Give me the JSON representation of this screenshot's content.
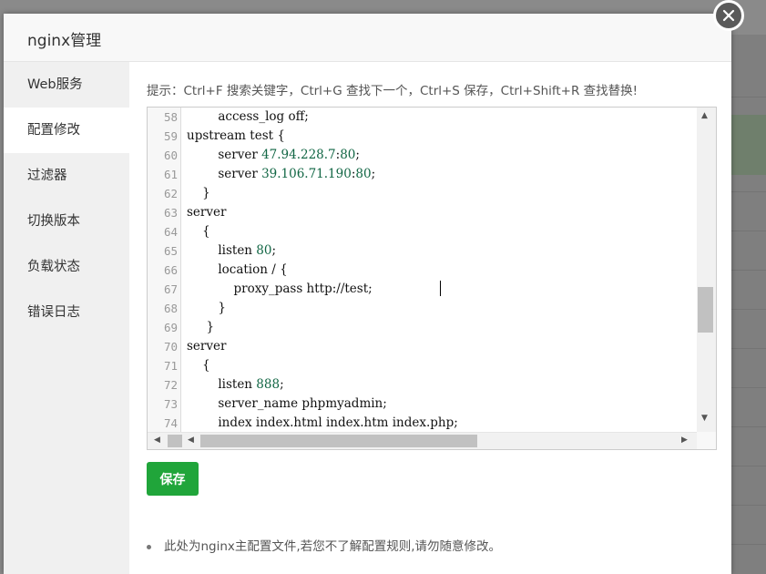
{
  "dialog": {
    "title": "nginx管理",
    "close_icon": "close-icon"
  },
  "sidebar": {
    "items": [
      {
        "label": "Web服务",
        "active": false
      },
      {
        "label": "配置修改",
        "active": true
      },
      {
        "label": "过滤器",
        "active": false
      },
      {
        "label": "切换版本",
        "active": false
      },
      {
        "label": "负载状态",
        "active": false
      },
      {
        "label": "错误日志",
        "active": false
      }
    ]
  },
  "main": {
    "hint": "提示：Ctrl+F 搜索关键字，Ctrl+G 查找下一个，Ctrl+S 保存，Ctrl+Shift+R 查找替换!",
    "editor": {
      "lines": [
        {
          "n": "58",
          "text": "        access_log off;"
        },
        {
          "n": "59",
          "text": "upstream test {"
        },
        {
          "n": "60",
          "text": "        server 47.94.228.7:80;"
        },
        {
          "n": "61",
          "text": "        server 39.106.71.190:80;"
        },
        {
          "n": "62",
          "text": "    }"
        },
        {
          "n": "63",
          "text": "server"
        },
        {
          "n": "64",
          "text": "    {"
        },
        {
          "n": "65",
          "text": "        listen 80;"
        },
        {
          "n": "66",
          "text": "        location / {"
        },
        {
          "n": "67",
          "text": "            proxy_pass http://test;"
        },
        {
          "n": "68",
          "text": "        }"
        },
        {
          "n": "69",
          "text": "     }"
        },
        {
          "n": "70",
          "text": "server"
        },
        {
          "n": "71",
          "text": "    {"
        },
        {
          "n": "72",
          "text": "        listen 888;"
        },
        {
          "n": "73",
          "text": "        server_name phpmyadmin;"
        },
        {
          "n": "74",
          "text": "        index index.html index.htm index.php;"
        }
      ]
    },
    "save_label": "保存",
    "note": "此处为nginx主配置文件,若您不了解配置规则,请勿随意修改。"
  },
  "colors": {
    "accent": "#20a53a",
    "number": "#116644"
  }
}
